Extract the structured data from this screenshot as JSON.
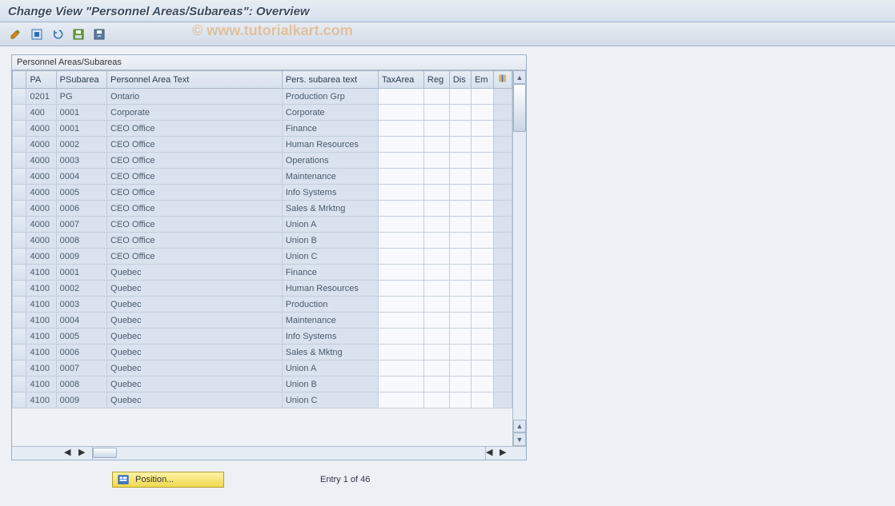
{
  "window": {
    "title": "Change View \"Personnel Areas/Subareas\": Overview"
  },
  "toolbar": {
    "buttons": [
      {
        "name": "change-detail-icon"
      },
      {
        "name": "select-all-icon"
      },
      {
        "name": "undo-icon"
      },
      {
        "name": "save-icon"
      },
      {
        "name": "delete-icon"
      }
    ]
  },
  "watermark": "© www.tutorialkart.com",
  "panel": {
    "caption": "Personnel Areas/Subareas",
    "columns": [
      "PA",
      "PSubarea",
      "Personnel Area Text",
      "Pers. subarea text",
      "TaxArea",
      "Reg",
      "Dis",
      "Em"
    ],
    "settings_icon": "table-settings-icon",
    "rows": [
      {
        "pa": "0201",
        "ps": "PG",
        "pat": "Ontario",
        "pst": "Production Grp",
        "tax": "",
        "reg": "",
        "dis": "",
        "em": ""
      },
      {
        "pa": "400",
        "ps": "0001",
        "pat": "Corporate",
        "pst": "Corporate",
        "tax": "",
        "reg": "",
        "dis": "",
        "em": ""
      },
      {
        "pa": "4000",
        "ps": "0001",
        "pat": "CEO Office",
        "pst": "Finance",
        "tax": "",
        "reg": "",
        "dis": "",
        "em": ""
      },
      {
        "pa": "4000",
        "ps": "0002",
        "pat": "CEO Office",
        "pst": "Human Resources",
        "tax": "",
        "reg": "",
        "dis": "",
        "em": ""
      },
      {
        "pa": "4000",
        "ps": "0003",
        "pat": "CEO Office",
        "pst": "Operations",
        "tax": "",
        "reg": "",
        "dis": "",
        "em": ""
      },
      {
        "pa": "4000",
        "ps": "0004",
        "pat": "CEO Office",
        "pst": "Maintenance",
        "tax": "",
        "reg": "",
        "dis": "",
        "em": ""
      },
      {
        "pa": "4000",
        "ps": "0005",
        "pat": "CEO Office",
        "pst": "Info Systems",
        "tax": "",
        "reg": "",
        "dis": "",
        "em": ""
      },
      {
        "pa": "4000",
        "ps": "0006",
        "pat": "CEO Office",
        "pst": "Sales & Mrktng",
        "tax": "",
        "reg": "",
        "dis": "",
        "em": ""
      },
      {
        "pa": "4000",
        "ps": "0007",
        "pat": "CEO Office",
        "pst": "Union A",
        "tax": "",
        "reg": "",
        "dis": "",
        "em": ""
      },
      {
        "pa": "4000",
        "ps": "0008",
        "pat": "CEO Office",
        "pst": "Union B",
        "tax": "",
        "reg": "",
        "dis": "",
        "em": ""
      },
      {
        "pa": "4000",
        "ps": "0009",
        "pat": "CEO Office",
        "pst": "Union C",
        "tax": "",
        "reg": "",
        "dis": "",
        "em": ""
      },
      {
        "pa": "4100",
        "ps": "0001",
        "pat": "Quebec",
        "pst": "Finance",
        "tax": "",
        "reg": "",
        "dis": "",
        "em": ""
      },
      {
        "pa": "4100",
        "ps": "0002",
        "pat": "Quebec",
        "pst": "Human Resources",
        "tax": "",
        "reg": "",
        "dis": "",
        "em": ""
      },
      {
        "pa": "4100",
        "ps": "0003",
        "pat": "Quebec",
        "pst": "Production",
        "tax": "",
        "reg": "",
        "dis": "",
        "em": ""
      },
      {
        "pa": "4100",
        "ps": "0004",
        "pat": "Quebec",
        "pst": "Maintenance",
        "tax": "",
        "reg": "",
        "dis": "",
        "em": ""
      },
      {
        "pa": "4100",
        "ps": "0005",
        "pat": "Quebec",
        "pst": "Info Systems",
        "tax": "",
        "reg": "",
        "dis": "",
        "em": ""
      },
      {
        "pa": "4100",
        "ps": "0006",
        "pat": "Quebec",
        "pst": "Sales & Mktng",
        "tax": "",
        "reg": "",
        "dis": "",
        "em": ""
      },
      {
        "pa": "4100",
        "ps": "0007",
        "pat": "Quebec",
        "pst": "Union A",
        "tax": "",
        "reg": "",
        "dis": "",
        "em": ""
      },
      {
        "pa": "4100",
        "ps": "0008",
        "pat": "Quebec",
        "pst": "Union B",
        "tax": "",
        "reg": "",
        "dis": "",
        "em": ""
      },
      {
        "pa": "4100",
        "ps": "0009",
        "pat": "Quebec",
        "pst": "Union C",
        "tax": "",
        "reg": "",
        "dis": "",
        "em": ""
      }
    ]
  },
  "footer": {
    "position_label": "Position...",
    "entry_text": "Entry 1 of 46"
  },
  "colors": {
    "header_bg": "#d6e0ee",
    "readonly_bg": "#d9e2ee",
    "accent_yellow": "#f0d94f"
  }
}
